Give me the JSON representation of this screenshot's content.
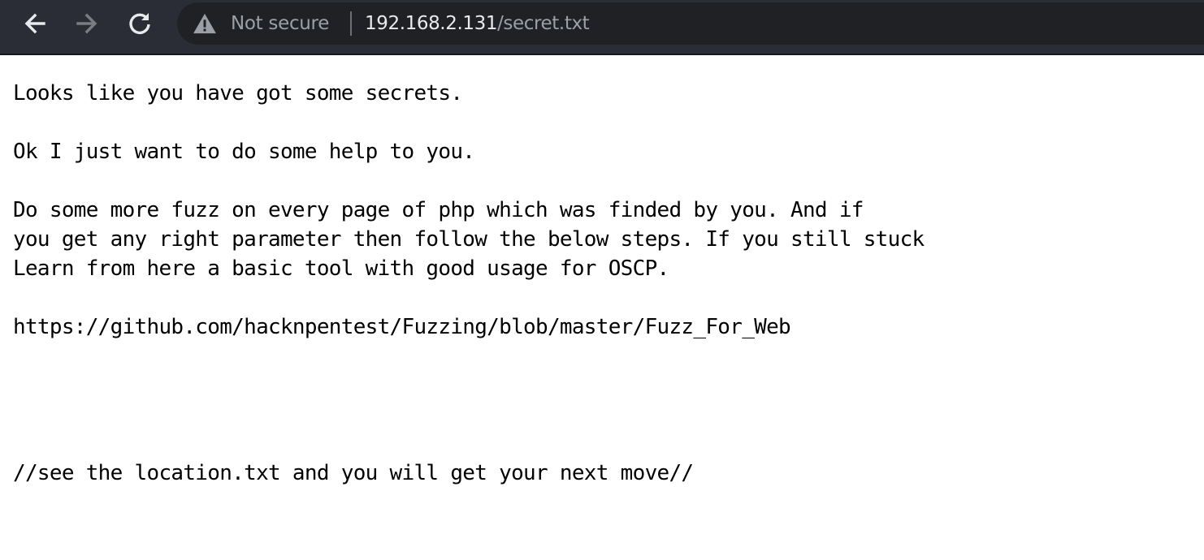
{
  "browser": {
    "security_label": "Not secure",
    "url_host": "192.168.2.131",
    "url_path": "/secret.txt",
    "icons": {
      "back": "arrow-left-icon",
      "forward": "arrow-right-icon",
      "reload": "reload-icon",
      "security": "warning-triangle-icon"
    },
    "colors": {
      "toolbar": "#2b2d36",
      "omnibox": "#202124",
      "url_host": "#e8eaed",
      "url_dim": "#9aa0a6"
    }
  },
  "document": {
    "lines": [
      "Looks like you have got some secrets.",
      "",
      "Ok I just want to do some help to you.",
      "",
      "Do some more fuzz on every page of php which was finded by you. And if",
      "you get any right parameter then follow the below steps. If you still stuck",
      "Learn from here a basic tool with good usage for OSCP.",
      "",
      "https://github.com/hacknpentest/Fuzzing/blob/master/Fuzz_For_Web",
      "",
      "",
      "",
      "",
      "//see the location.txt and you will get your next move//"
    ]
  }
}
